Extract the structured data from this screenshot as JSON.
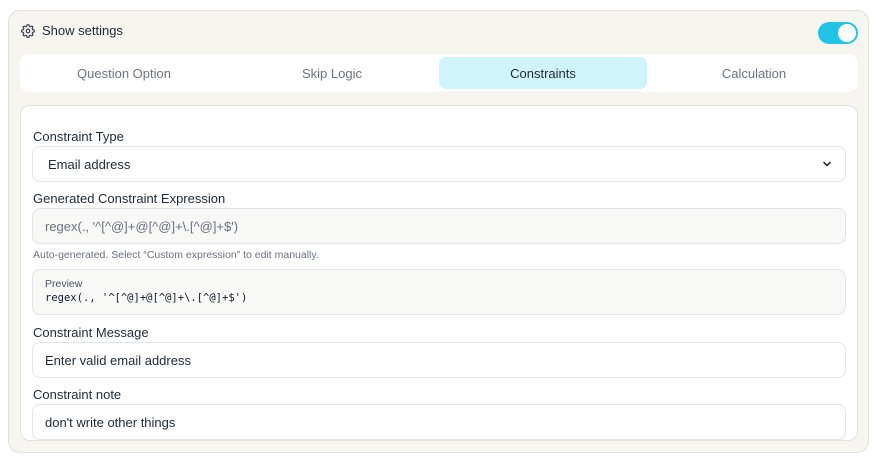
{
  "header": {
    "title": "Show settings",
    "toggle_on": true,
    "accent": "#22c3e6"
  },
  "tabs": [
    {
      "label": "Question Option",
      "active": false
    },
    {
      "label": "Skip Logic",
      "active": false
    },
    {
      "label": "Constraints",
      "active": true
    },
    {
      "label": "Calculation",
      "active": false
    }
  ],
  "form": {
    "constraint_type": {
      "label": "Constraint Type",
      "value": "Email address"
    },
    "generated_expression": {
      "label": "Generated Constraint Expression",
      "value": "regex(., '^[^@]+@[^@]+\\.[^@]+$')",
      "hint": "Auto-generated. Select “Custom expression” to edit manually."
    },
    "preview": {
      "label": "Preview",
      "code": "regex(., '^[^@]+@[^@]+\\.[^@]+$')"
    },
    "constraint_message": {
      "label": "Constraint Message",
      "value": "Enter valid email address"
    },
    "constraint_note": {
      "label": "Constraint note",
      "value": "don't write other things"
    }
  }
}
